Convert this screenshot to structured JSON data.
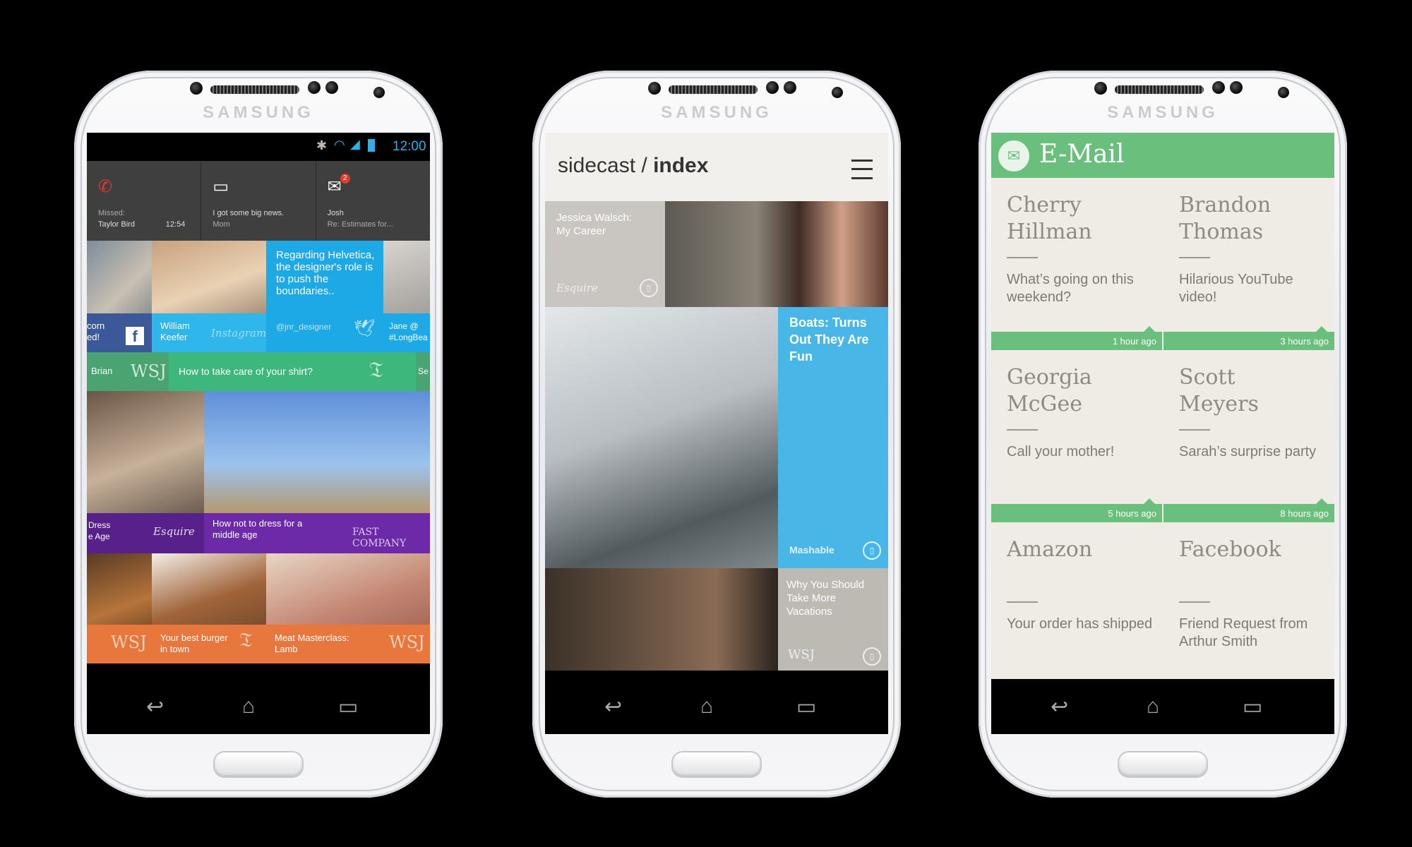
{
  "device_brand": "SAMSUNG",
  "phone1": {
    "status": {
      "time": "12:00"
    },
    "notifications": [
      {
        "line1": "Missed:",
        "line2": "Taylor Bird",
        "time": "12:54",
        "icon": "phone-missed-icon"
      },
      {
        "line1": "I got some big news.",
        "line2": "Mom",
        "icon": "message-icon"
      },
      {
        "line1": "Josh",
        "line2": "Re: Estimates for...",
        "badge": "2",
        "icon": "mail-icon"
      }
    ],
    "tiles": {
      "fb_partial": "corn\ned!",
      "instagram_name": "William\nKeefer",
      "instagram_brand": "Instagram",
      "tweet_text": "Regarding Helvetica, the designer's role is to push the boundaries..",
      "tweet_handle": "@jnr_designer",
      "jane": "Jane @\n#LongBea",
      "wsj_partial": "Brian",
      "wsj_logo": "WSJ",
      "nyt_headline": "How to take care of your shirt?",
      "nyt_right_partial": "Se",
      "esquire_partial": "Dress\ne Age",
      "esquire_logo": "Esquire",
      "fastco_headline": "How not to dress for a middle age",
      "fastco_logo": "FAST COMPANY",
      "wsj2_logo": "WSJ",
      "burger_headline": "Your best burger in town",
      "meat_headline": "Meat Masterclass: Lamb",
      "wsj3_logo": "WSJ"
    }
  },
  "phone2": {
    "title_light": "sidecast / ",
    "title_bold": "index",
    "articles": [
      {
        "title": "Jessica Walsch: My Career",
        "source": "Esquire"
      },
      {
        "title": "Boats: Turns Out They Are Fun",
        "source": "Mashable"
      },
      {
        "title": "Why You Should Take More Vacations",
        "source": "WSJ"
      }
    ]
  },
  "phone3": {
    "title": "E-Mail",
    "emails": [
      {
        "name": "Cherry Hillman",
        "message": "What’s going on this weekend?",
        "time": "1 hour ago"
      },
      {
        "name": "Brandon Thomas",
        "message": "Hilarious YouTube video!",
        "time": "3 hours ago"
      },
      {
        "name": "Georgia McGee",
        "message": "Call your mother!",
        "time": "5 hours ago"
      },
      {
        "name": "Scott Meyers",
        "message": "Sarah’s surprise party",
        "time": "8 hours ago"
      },
      {
        "name": "Amazon",
        "message": "Your order has shipped",
        "time": ""
      },
      {
        "name": "Facebook",
        "message": "Friend Request from Arthur Smith",
        "time": ""
      }
    ]
  },
  "colors": {
    "twitter_blue": "#1ca9e6",
    "instagram_blue": "#2fb6ea",
    "nyt_green": "#3db77b",
    "purple": "#6d2aa8",
    "orange": "#e8773e",
    "mashable_blue": "#49b6e8",
    "email_green": "#6bbf7c"
  }
}
